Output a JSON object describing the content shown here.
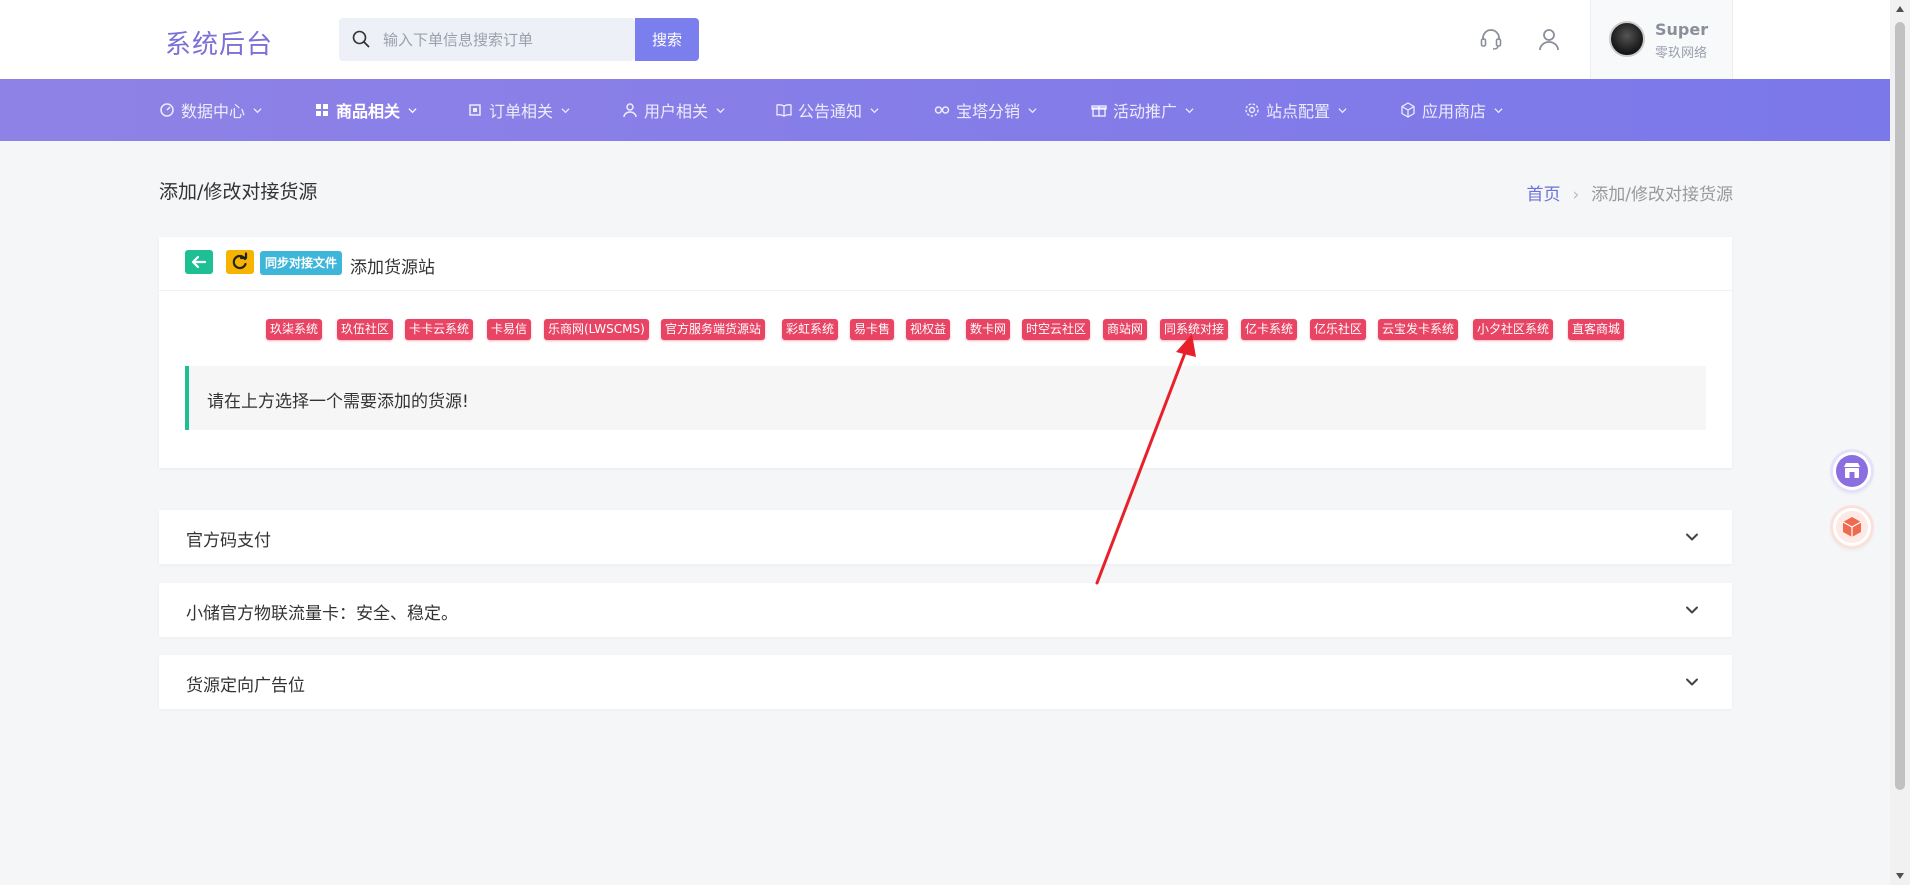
{
  "header": {
    "logo": "系统后台",
    "search": {
      "placeholder": "输入下单信息搜索订单",
      "button": "搜索"
    },
    "user": {
      "name": "Super",
      "role": "零玖网络"
    }
  },
  "nav": [
    {
      "label": "数据中心",
      "icon": "dashboard-icon",
      "active": false
    },
    {
      "label": "商品相关",
      "icon": "grid-icon",
      "active": true
    },
    {
      "label": "订单相关",
      "icon": "order-icon",
      "active": false
    },
    {
      "label": "用户相关",
      "icon": "user-icon",
      "active": false
    },
    {
      "label": "公告通知",
      "icon": "book-icon",
      "active": false
    },
    {
      "label": "宝塔分销",
      "icon": "link-icon",
      "active": false
    },
    {
      "label": "活动推广",
      "icon": "gift-icon",
      "active": false
    },
    {
      "label": "站点配置",
      "icon": "gear-icon",
      "active": false
    },
    {
      "label": "应用商店",
      "icon": "box-icon",
      "active": false
    }
  ],
  "page": {
    "title": "添加/修改对接货源",
    "breadcrumb": {
      "home": "首页",
      "current": "添加/修改对接货源"
    }
  },
  "card": {
    "sync_badge": "同步对接文件",
    "title": "添加货源站",
    "tags": [
      "玖柒系统",
      "玖伍社区",
      "卡卡云系统",
      "卡易信",
      "乐商网(LWSCMS)",
      "官方服务端货源站",
      "彩虹系统",
      "易卡售",
      "视权益",
      "数卡网",
      "时空云社区",
      "商站网",
      "同系统对接",
      "亿卡系统",
      "亿乐社区",
      "云宝发卡系统",
      "小夕社区系统",
      "直客商城"
    ],
    "notice": "请在上方选择一个需要添加的货源!"
  },
  "accordions": [
    {
      "label": "官方码支付"
    },
    {
      "label": "小储官方物联流量卡：安全、稳定。"
    },
    {
      "label": "货源定向广告位"
    }
  ],
  "colors": {
    "accent": "#7b78ea",
    "tag": "#e84565",
    "success": "#1fbf94",
    "warning": "#f6b300",
    "info": "#3db6d9",
    "annotation": "#e8202a"
  }
}
